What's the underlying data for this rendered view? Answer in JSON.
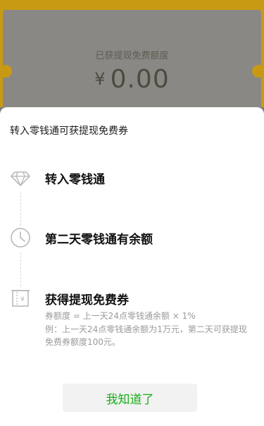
{
  "background": {
    "label": "已获提现免费额度",
    "currency": "¥",
    "amount": "0.00"
  },
  "sheet": {
    "title": "转入零钱通可获提现免费券",
    "steps": [
      {
        "icon": "diamond-icon",
        "title": "转入零钱通"
      },
      {
        "icon": "clock-icon",
        "title": "第二天零钱通有余额"
      },
      {
        "icon": "coupon-icon",
        "title": "获得提现免费券",
        "desc_line1": "券额度 = 上一天24点零钱通余额 × 1%",
        "desc_line2": "例：上一天24点零钱通余额为1万元，第二天可获提现免费券额度100元。"
      }
    ],
    "button_label": "我知道了"
  },
  "colors": {
    "accent_green": "#1aad19",
    "background_yellow": "#c89a14"
  }
}
